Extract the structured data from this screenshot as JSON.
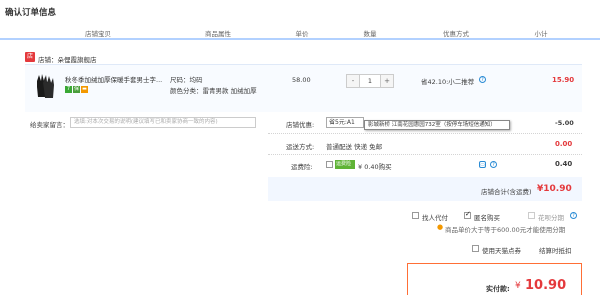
{
  "page_title": "确认订单信息",
  "table_headers": [
    "店铺宝贝",
    "商品属性",
    "单价",
    "数量",
    "优惠方式",
    "小计"
  ],
  "shop": {
    "icon": "shop-icon",
    "label": "店铺：",
    "name": "朵俚霞旗舰店"
  },
  "item": {
    "title": "秋冬季加绒加厚保暖手套男士字...",
    "attr_size": "尺码：均码",
    "attr_color": "颜色分类：雷青男款 加绒加厚",
    "price": "58.00",
    "quantity": "1",
    "qty_minus": "-",
    "qty_plus": "+",
    "discount": "省42.10:小二推荐",
    "subtotal": "15.90"
  },
  "message": {
    "label": "给卖家留言：",
    "placeholder": "选填:对本次交易的说明(建议填写已和卖家协商一致的内容)"
  },
  "store_promo": {
    "label": "店铺优惠:",
    "selected": "省5元:A1",
    "tooltip": "影城新桥 江南花园惠园732室（按停车场短信通知）",
    "amount": "-5.00"
  },
  "shipping": {
    "label": "运送方式:",
    "value": "普通配送 快递 免邮",
    "amount": "0.00"
  },
  "insurance": {
    "label": "运费险:",
    "tag": "运费险",
    "value": "¥ 0.40购买",
    "amount": "0.40"
  },
  "store_total": {
    "label": "店铺合计(含运费)",
    "amount": "¥10.90"
  },
  "options": {
    "proxy": "找人代付",
    "anonymous": "匿名购买",
    "installment": "花呗分期",
    "note": "商品单价大于等于600.00元才能使用分期",
    "tmall_points": "使用天猫点券",
    "points_right": "结算时抵扣"
  },
  "payment": {
    "label": "实付款:",
    "currency": "¥",
    "amount": "10.90"
  },
  "colors": {
    "accent": "#e4393c",
    "header_line": "#b2d1ff",
    "pay_border": "#ff6f36"
  }
}
